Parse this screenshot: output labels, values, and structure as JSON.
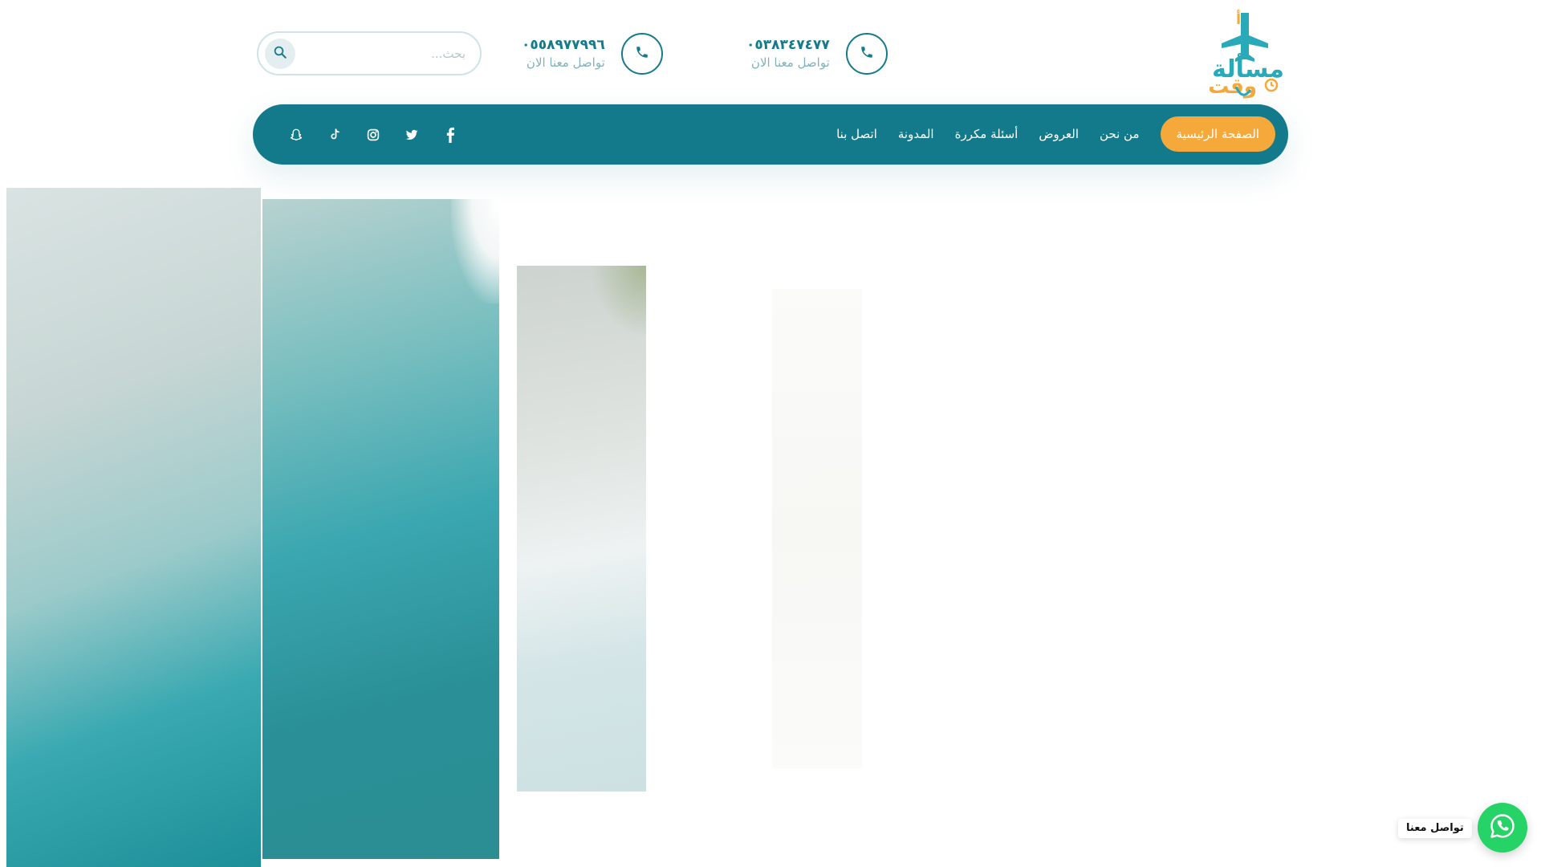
{
  "header": {
    "logo": {
      "text_top": "أ",
      "text_main": "مسألة",
      "text_sub": "وقت",
      "colors": {
        "teal": "#2aa9b8",
        "orange": "#f5a93a"
      }
    },
    "contacts": [
      {
        "phone": "٠٥٣٨٣٤٧٤٧٧",
        "label": "تواصل معنا الان",
        "icon": "phone-icon"
      },
      {
        "phone": "٠٥٥٨٩٧٧٩٩٦",
        "label": "تواصل معنا الان",
        "icon": "phone-icon"
      }
    ],
    "search": {
      "placeholder": "بحث...",
      "value": "",
      "icon": "search-icon"
    }
  },
  "nav": {
    "items": [
      {
        "label": "الصفحة الرئيسية",
        "active": true
      },
      {
        "label": "من نحن",
        "active": false
      },
      {
        "label": "العروض",
        "active": false
      },
      {
        "label": "أسئلة مكررة",
        "active": false
      },
      {
        "label": "المدونة",
        "active": false
      },
      {
        "label": "اتصل بنا",
        "active": false
      }
    ],
    "social": [
      "facebook-icon",
      "twitter-icon",
      "instagram-icon",
      "tiktok-icon",
      "snapchat-icon"
    ]
  },
  "whatsapp": {
    "label": "تواصل معنا",
    "icon": "whatsapp-icon"
  },
  "colors": {
    "primary": "#127a8a",
    "accent": "#f5a93a",
    "whatsapp": "#25d366"
  }
}
